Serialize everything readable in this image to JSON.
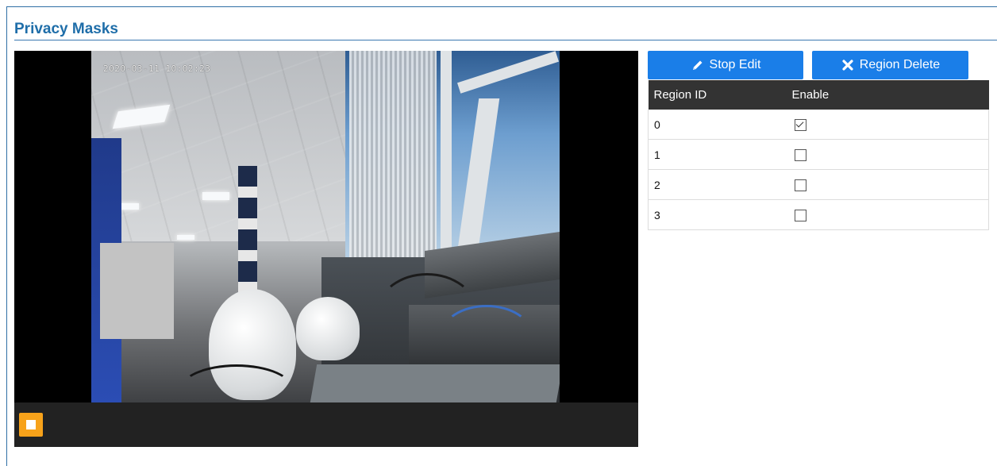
{
  "page": {
    "section_title": "Privacy Masks"
  },
  "video": {
    "timestamp": "2020-03-11 10:02:23",
    "stop_icon": "stop-icon"
  },
  "actions": {
    "stop_edit_label": "Stop Edit",
    "stop_edit_icon": "pencil-icon",
    "region_delete_label": "Region Delete",
    "region_delete_icon": "x-icon"
  },
  "regions": {
    "headers": [
      "Region ID",
      "Enable"
    ],
    "rows": [
      {
        "id": "0",
        "enabled": true
      },
      {
        "id": "1",
        "enabled": false
      },
      {
        "id": "2",
        "enabled": false
      },
      {
        "id": "3",
        "enabled": false
      }
    ]
  },
  "colors": {
    "accent_blue": "#1a7ee8",
    "title_blue": "#1f6ea9",
    "header_dark": "#333333",
    "stop_orange": "#f7a21a"
  }
}
